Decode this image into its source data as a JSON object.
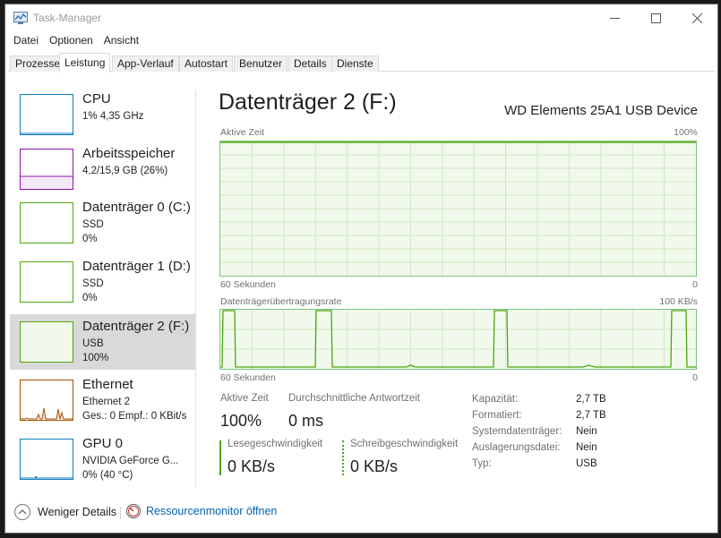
{
  "window": {
    "title": "Task-Manager"
  },
  "menu": [
    "Datei",
    "Optionen",
    "Ansicht"
  ],
  "tabs": [
    "Prozesse",
    "Leistung",
    "App-Verlauf",
    "Autostart",
    "Benutzer",
    "Details",
    "Dienste"
  ],
  "active_tab": "Leistung",
  "sidebar": [
    {
      "title": "CPU",
      "line1": "1% 4,35 GHz",
      "line2": "",
      "color": "#117dbb"
    },
    {
      "title": "Arbeitsspeicher",
      "line1": "4,2/15,9 GB (26%)",
      "line2": "",
      "color": "#8b12ae"
    },
    {
      "title": "Datenträger 0 (C:)",
      "line1": "SSD",
      "line2": "0%",
      "color": "#4da60c"
    },
    {
      "title": "Datenträger 1 (D:)",
      "line1": "SSD",
      "line2": "0%",
      "color": "#4da60c"
    },
    {
      "title": "Datenträger 2 (F:)",
      "line1": "USB",
      "line2": "100%",
      "color": "#4da60c",
      "selected": true
    },
    {
      "title": "Ethernet",
      "line1": "Ethernet 2",
      "line2": "Ges.: 0 Empf.: 0 KBit/s",
      "color": "#a74f01"
    },
    {
      "title": "GPU 0",
      "line1": "NVIDIA GeForce G...",
      "line2": "0% (40 °C)",
      "color": "#117dbb"
    }
  ],
  "main": {
    "title": "Datenträger 2 (F:)",
    "device": "WD Elements 25A1 USB Device",
    "graph1": {
      "label": "Aktive Zeit",
      "max": "100%",
      "time": "60 Sekunden",
      "min": "0",
      "level": 1.0
    },
    "graph2": {
      "label": "Datenträgerübertragungsrate",
      "max": "100 KB/s",
      "time": "60 Sekunden",
      "min": "0"
    },
    "stats": {
      "active_label": "Aktive Zeit",
      "active_value": "100%",
      "response_label": "Durchschnittliche Antwortzeit",
      "response_value": "0 ms",
      "read_label": "Lesegeschwindigkeit",
      "read_value": "0 KB/s",
      "write_label": "Schreibgeschwindigkeit",
      "write_value": "0 KB/s"
    },
    "properties": [
      {
        "label": "Kapazität:",
        "value": "2,7 TB"
      },
      {
        "label": "Formatiert:",
        "value": "2,7 TB"
      },
      {
        "label": "Systemdatenträger:",
        "value": "Nein"
      },
      {
        "label": "Auslagerungsdatei:",
        "value": "Nein"
      },
      {
        "label": "Typ:",
        "value": "USB"
      }
    ]
  },
  "footer": {
    "less_details": "Weniger Details",
    "resource_monitor": "Ressourcenmonitor öffnen"
  },
  "colors": {
    "disk": "#4da60c",
    "disk_fill": "#f1f9ec",
    "link": "#0063b1"
  }
}
